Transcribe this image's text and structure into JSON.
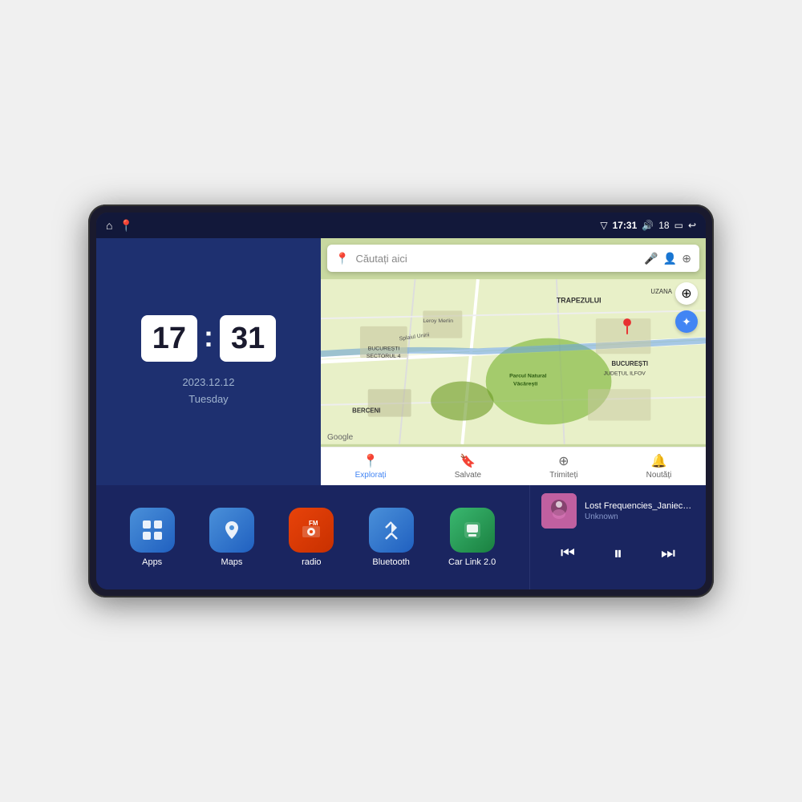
{
  "device": {
    "screen_bg": "#1e2a5e"
  },
  "status_bar": {
    "signal_icon": "▽",
    "time": "17:31",
    "volume_icon": "🔊",
    "battery_level": "18",
    "battery_icon": "▭",
    "back_icon": "↩"
  },
  "clock": {
    "hours": "17",
    "minutes": "31",
    "date": "2023.12.12",
    "day": "Tuesday"
  },
  "map": {
    "search_placeholder": "Căutați aici",
    "bottom_items": [
      {
        "label": "Explorați",
        "icon": "📍",
        "active": true
      },
      {
        "label": "Salvate",
        "icon": "🔖",
        "active": false
      },
      {
        "label": "Trimiteți",
        "icon": "⊕",
        "active": false
      },
      {
        "label": "Noutăți",
        "icon": "🔔",
        "active": false
      }
    ],
    "labels": {
      "trapezului": "TRAPEZULUI",
      "parcul": "Parcul Natural Văcărești",
      "leroy": "Leroy Merlin",
      "berceni": "BERCENI",
      "bucuresti": "BUCUREȘTI",
      "judetul": "JUDEȚUL ILFOV",
      "sector4": "BUCUREȘTI\nSECTORUL 4",
      "uzana": "UZANA",
      "splai": "Splaiul Unirii"
    }
  },
  "apps": [
    {
      "id": "apps",
      "label": "Apps",
      "icon": "⊞",
      "color_class": "app-icon-apps"
    },
    {
      "id": "maps",
      "label": "Maps",
      "icon": "📍",
      "color_class": "app-icon-maps"
    },
    {
      "id": "radio",
      "label": "radio",
      "icon": "📻",
      "color_class": "app-icon-radio"
    },
    {
      "id": "bluetooth",
      "label": "Bluetooth",
      "icon": "🔷",
      "color_class": "app-icon-bluetooth"
    },
    {
      "id": "carlink",
      "label": "Car Link 2.0",
      "icon": "📱",
      "color_class": "app-icon-carlink"
    }
  ],
  "music": {
    "title": "Lost Frequencies_Janieck Devy-...",
    "artist": "Unknown",
    "prev_icon": "⏮",
    "play_icon": "⏸",
    "next_icon": "⏭"
  }
}
